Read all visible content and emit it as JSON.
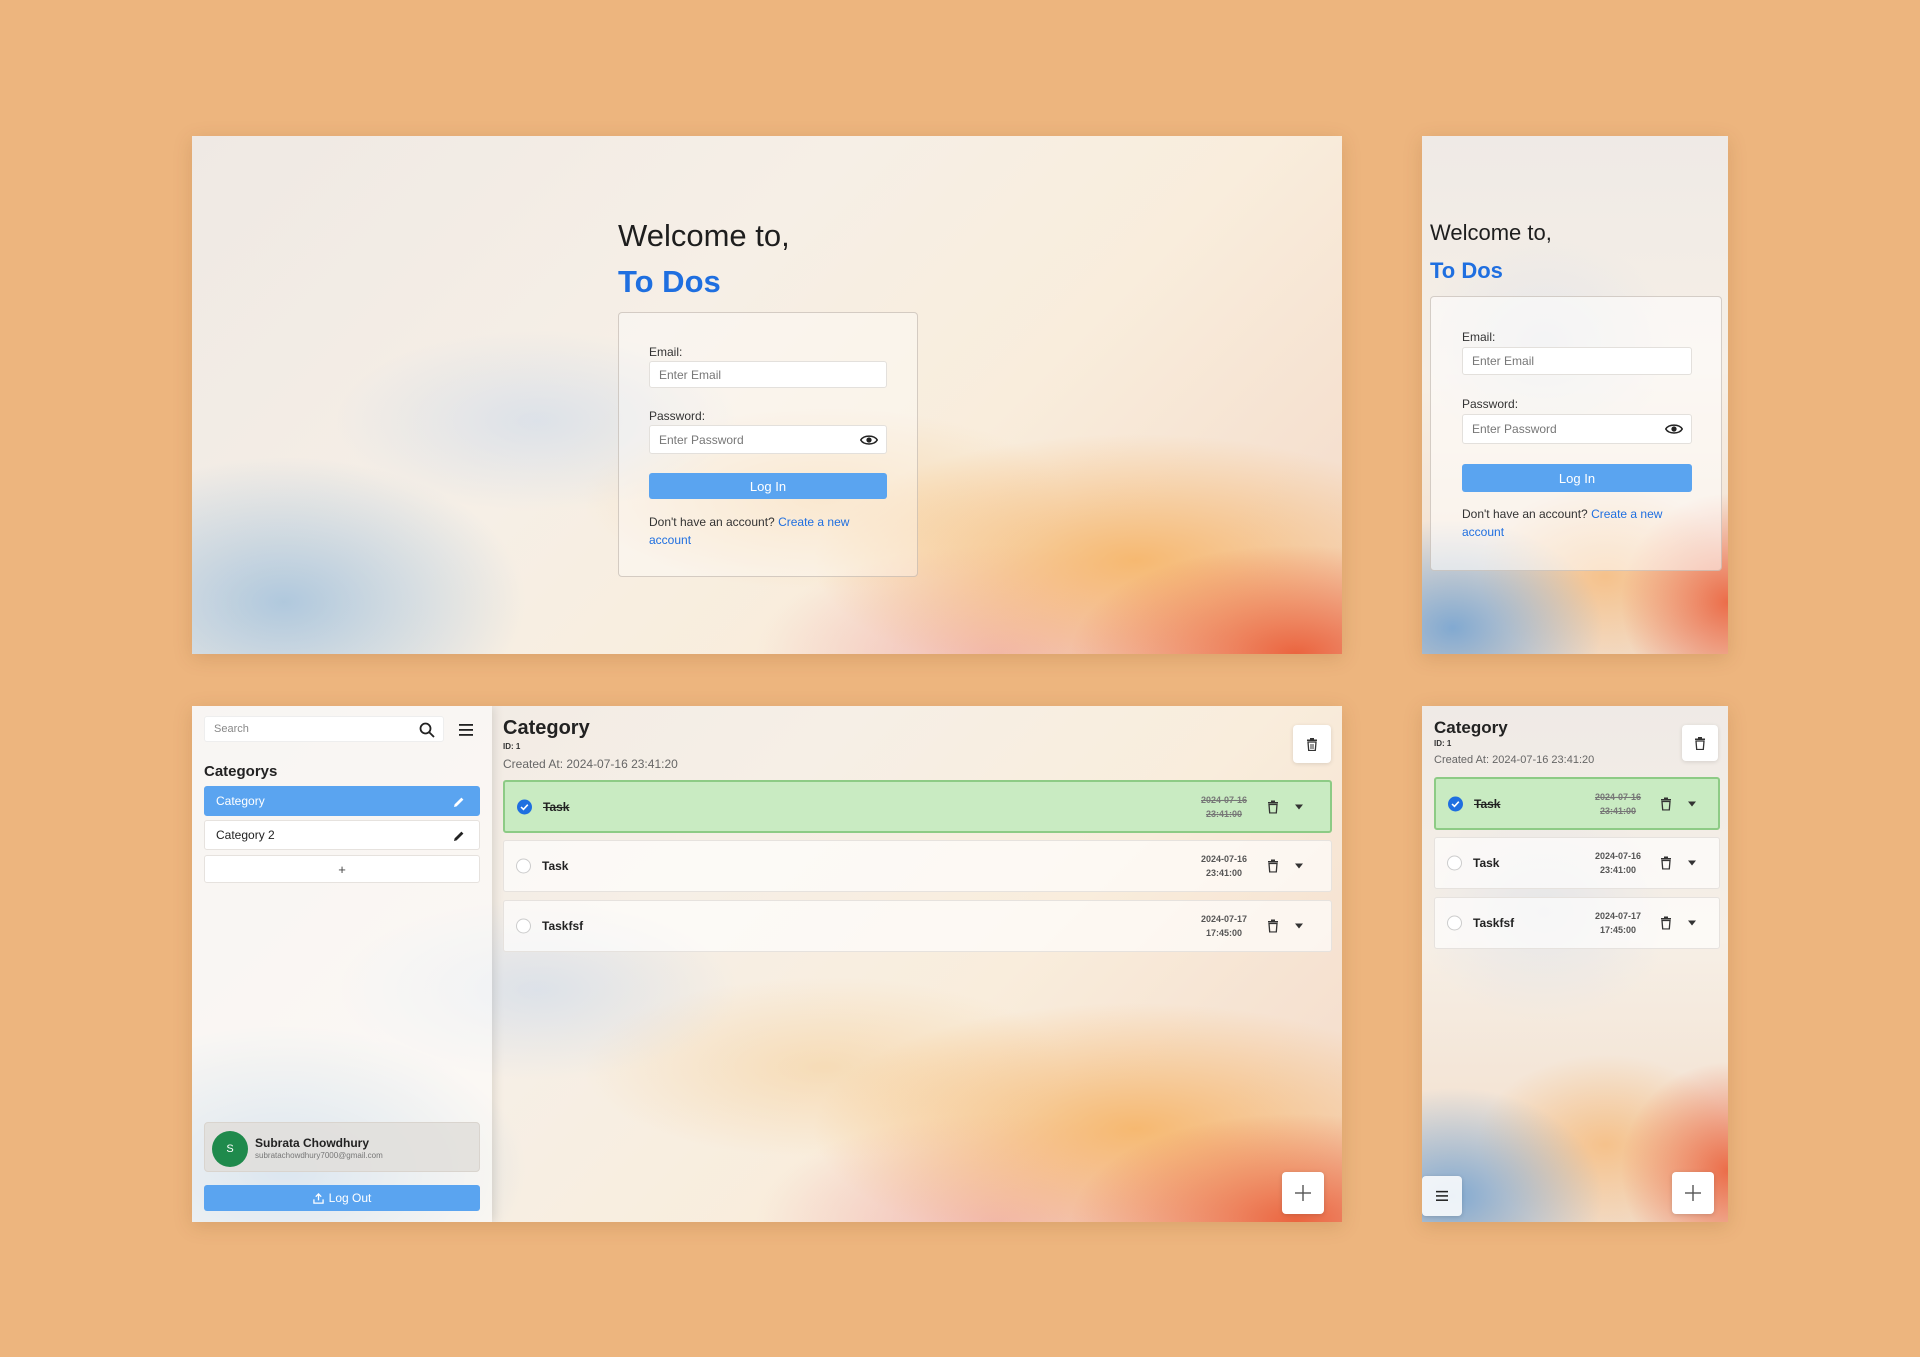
{
  "login": {
    "welcome": "Welcome to,",
    "brand": "To Dos",
    "email_label": "Email:",
    "email_placeholder": "Enter Email",
    "password_label": "Password:",
    "password_placeholder": "Enter Password",
    "login_button": "Log In",
    "signup_prompt": "Don't have an account?",
    "signup_link_line1": "Create a new",
    "signup_link_line2": "account"
  },
  "sidebar": {
    "search_placeholder": "Search",
    "heading": "Categorys",
    "items": [
      {
        "label": "Category",
        "active": true
      },
      {
        "label": "Category 2",
        "active": false
      }
    ],
    "add_label": "+",
    "user": {
      "initial": "S",
      "name": "Subrata Chowdhury",
      "email": "subratachowdhury7000@gmail.com"
    },
    "logout_label": "Log Out"
  },
  "category": {
    "title": "Category",
    "id": "ID: 1",
    "created": "Created At: 2024-07-16 23:41:20",
    "tasks": [
      {
        "name": "Task",
        "date": "2024-07-16",
        "time": "23:41:00",
        "done": true
      },
      {
        "name": "Task",
        "date": "2024-07-16",
        "time": "23:41:00",
        "done": false
      },
      {
        "name": "Taskfsf",
        "date": "2024-07-17",
        "time": "17:45:00",
        "done": false
      }
    ]
  },
  "colors": {
    "background": "#EDB57E",
    "accent": "#5aa4f0",
    "brand": "#1f6fe0",
    "done_task": "#c9ebc2",
    "avatar": "#1f8a4c"
  },
  "icons": [
    "eye-icon",
    "search-icon",
    "menu-icon",
    "pencil-icon",
    "trash-icon",
    "chevron-down-icon",
    "check-icon",
    "plus-icon",
    "upload-icon"
  ]
}
